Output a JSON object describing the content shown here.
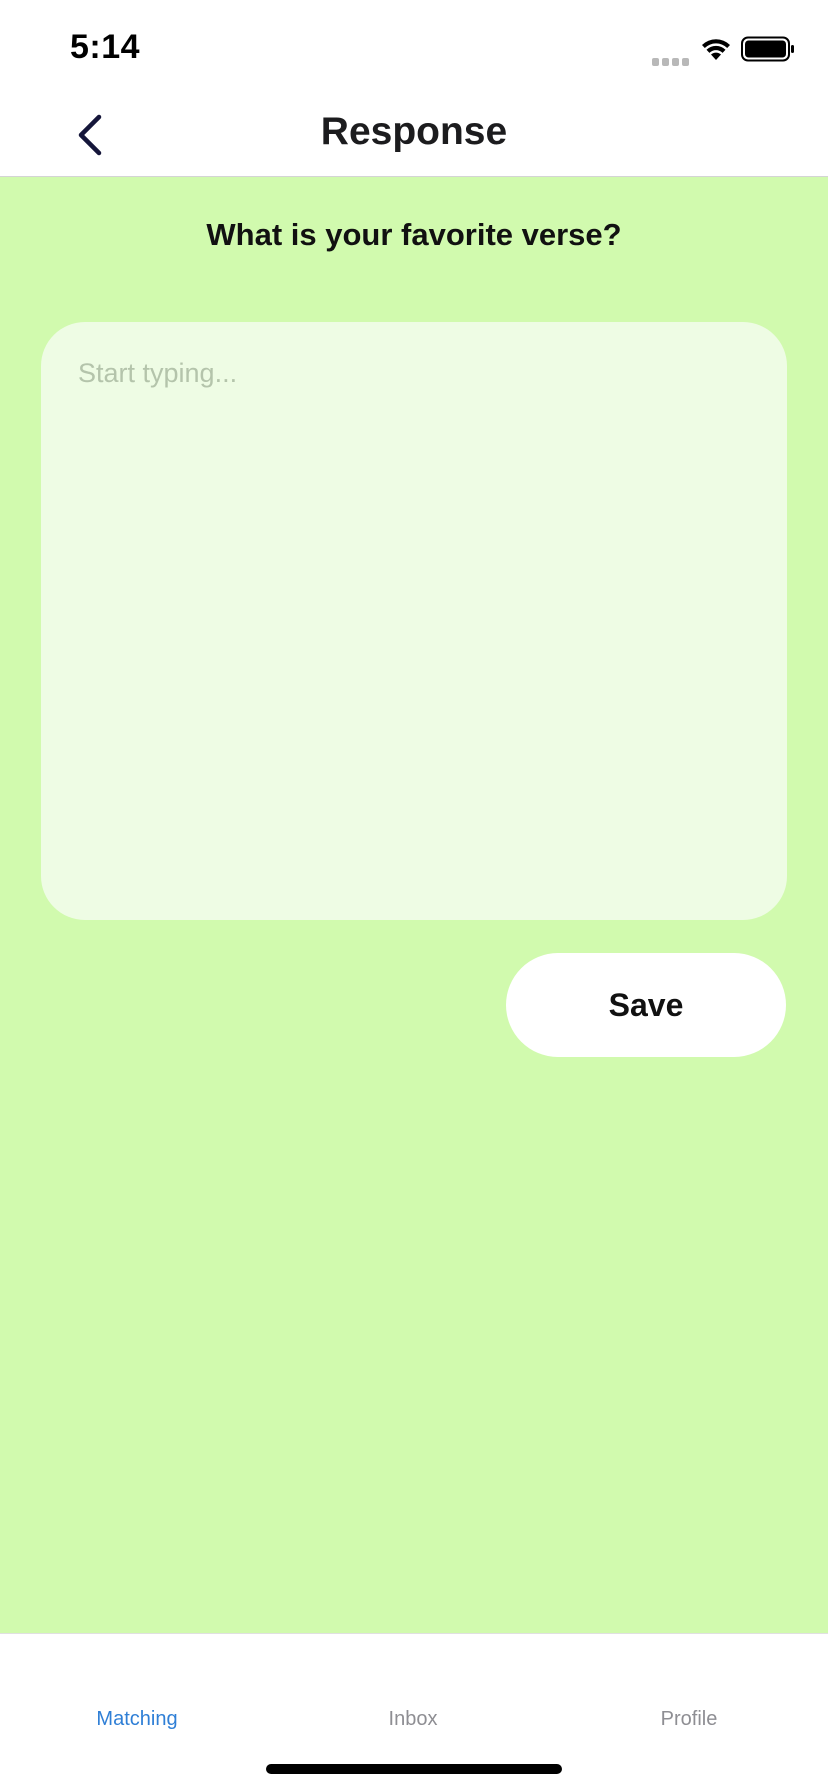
{
  "status_bar": {
    "time": "5:14",
    "signal_icon": "signal-icon",
    "wifi_icon": "wifi-icon",
    "battery_icon": "battery-icon"
  },
  "nav": {
    "back_icon": "chevron-left-icon",
    "title": "Response"
  },
  "content": {
    "question": "What is your favorite verse?",
    "response_value": "",
    "response_placeholder": "Start typing...",
    "save_label": "Save",
    "background_color": "#d1faae"
  },
  "tab_bar": {
    "tabs": [
      {
        "label": "Matching",
        "active": true
      },
      {
        "label": "Inbox",
        "active": false
      },
      {
        "label": "Profile",
        "active": false
      }
    ],
    "active_color": "#2f7fd6",
    "inactive_color": "#8e8e93"
  }
}
